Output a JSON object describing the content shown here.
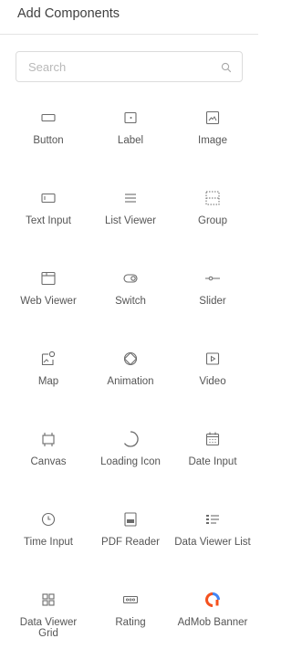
{
  "panel": {
    "title": "Add Components"
  },
  "search": {
    "placeholder": "Search",
    "value": ""
  },
  "components": [
    [
      {
        "label": "Button",
        "icon": "button-icon"
      },
      {
        "label": "Label",
        "icon": "label-icon"
      },
      {
        "label": "Image",
        "icon": "image-icon"
      }
    ],
    [
      {
        "label": "Text Input",
        "icon": "text-input-icon"
      },
      {
        "label": "List Viewer",
        "icon": "list-viewer-icon"
      },
      {
        "label": "Group",
        "icon": "group-icon"
      }
    ],
    [
      {
        "label": "Web Viewer",
        "icon": "web-viewer-icon"
      },
      {
        "label": "Switch",
        "icon": "switch-icon"
      },
      {
        "label": "Slider",
        "icon": "slider-icon"
      }
    ],
    [
      {
        "label": "Map",
        "icon": "map-icon"
      },
      {
        "label": "Animation",
        "icon": "animation-icon"
      },
      {
        "label": "Video",
        "icon": "video-icon"
      }
    ],
    [
      {
        "label": "Canvas",
        "icon": "canvas-icon"
      },
      {
        "label": "Loading Icon",
        "icon": "loading-icon"
      },
      {
        "label": "Date Input",
        "icon": "date-input-icon"
      }
    ],
    [
      {
        "label": "Time Input",
        "icon": "time-input-icon"
      },
      {
        "label": "PDF Reader",
        "icon": "pdf-reader-icon"
      },
      {
        "label": "Data Viewer List",
        "icon": "data-viewer-list-icon"
      }
    ],
    [
      {
        "label": "Data Viewer Grid",
        "icon": "data-viewer-grid-icon"
      },
      {
        "label": "Rating",
        "icon": "rating-icon"
      },
      {
        "label": "AdMob Banner",
        "icon": "admob-banner-icon"
      }
    ]
  ],
  "colors": {
    "icon_stroke": "#6b6b6b",
    "admob_orange": "#f4511e",
    "admob_blue": "#4285f4"
  }
}
